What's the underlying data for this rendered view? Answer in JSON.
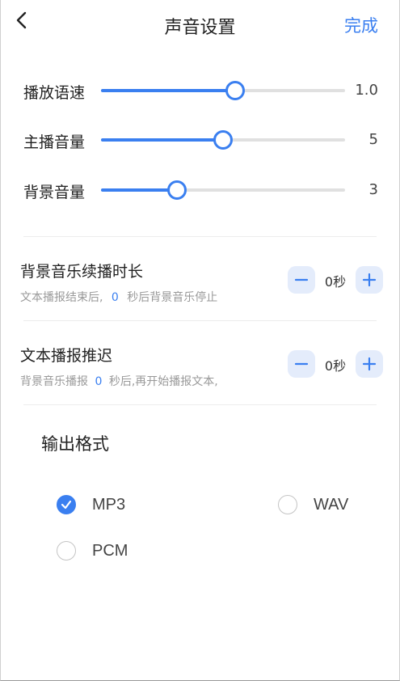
{
  "header": {
    "title": "声音设置",
    "done_label": "完成"
  },
  "sliders": [
    {
      "label": "播放语速",
      "value_text": "1.0",
      "level": 0.55
    },
    {
      "label": "主播音量",
      "value_text": "5",
      "level": 0.5
    },
    {
      "label": "背景音量",
      "value_text": "3",
      "level": 0.31
    }
  ],
  "bg_music_duration": {
    "title": "背景音乐续播时长",
    "desc_prefix": "文本播报结束后,",
    "desc_value": "0",
    "desc_suffix": "秒后背景音乐停止",
    "value_text": "0秒"
  },
  "text_delay": {
    "title": "文本播报推迟",
    "desc_prefix": "背景音乐播报",
    "desc_value": "0",
    "desc_suffix": "秒后,再开始播报文本,",
    "value_text": "0秒"
  },
  "output_format": {
    "title": "输出格式",
    "options": [
      {
        "label": "MP3",
        "checked": true
      },
      {
        "label": "WAV",
        "checked": false
      },
      {
        "label": "PCM",
        "checked": false
      }
    ]
  },
  "colors": {
    "accent": "#3a7ff0",
    "track": "#e0e0e0",
    "stepper_bg": "#e4ecfb"
  },
  "icons": [
    "chevron-left-icon",
    "minus-icon",
    "plus-icon",
    "check-icon"
  ]
}
